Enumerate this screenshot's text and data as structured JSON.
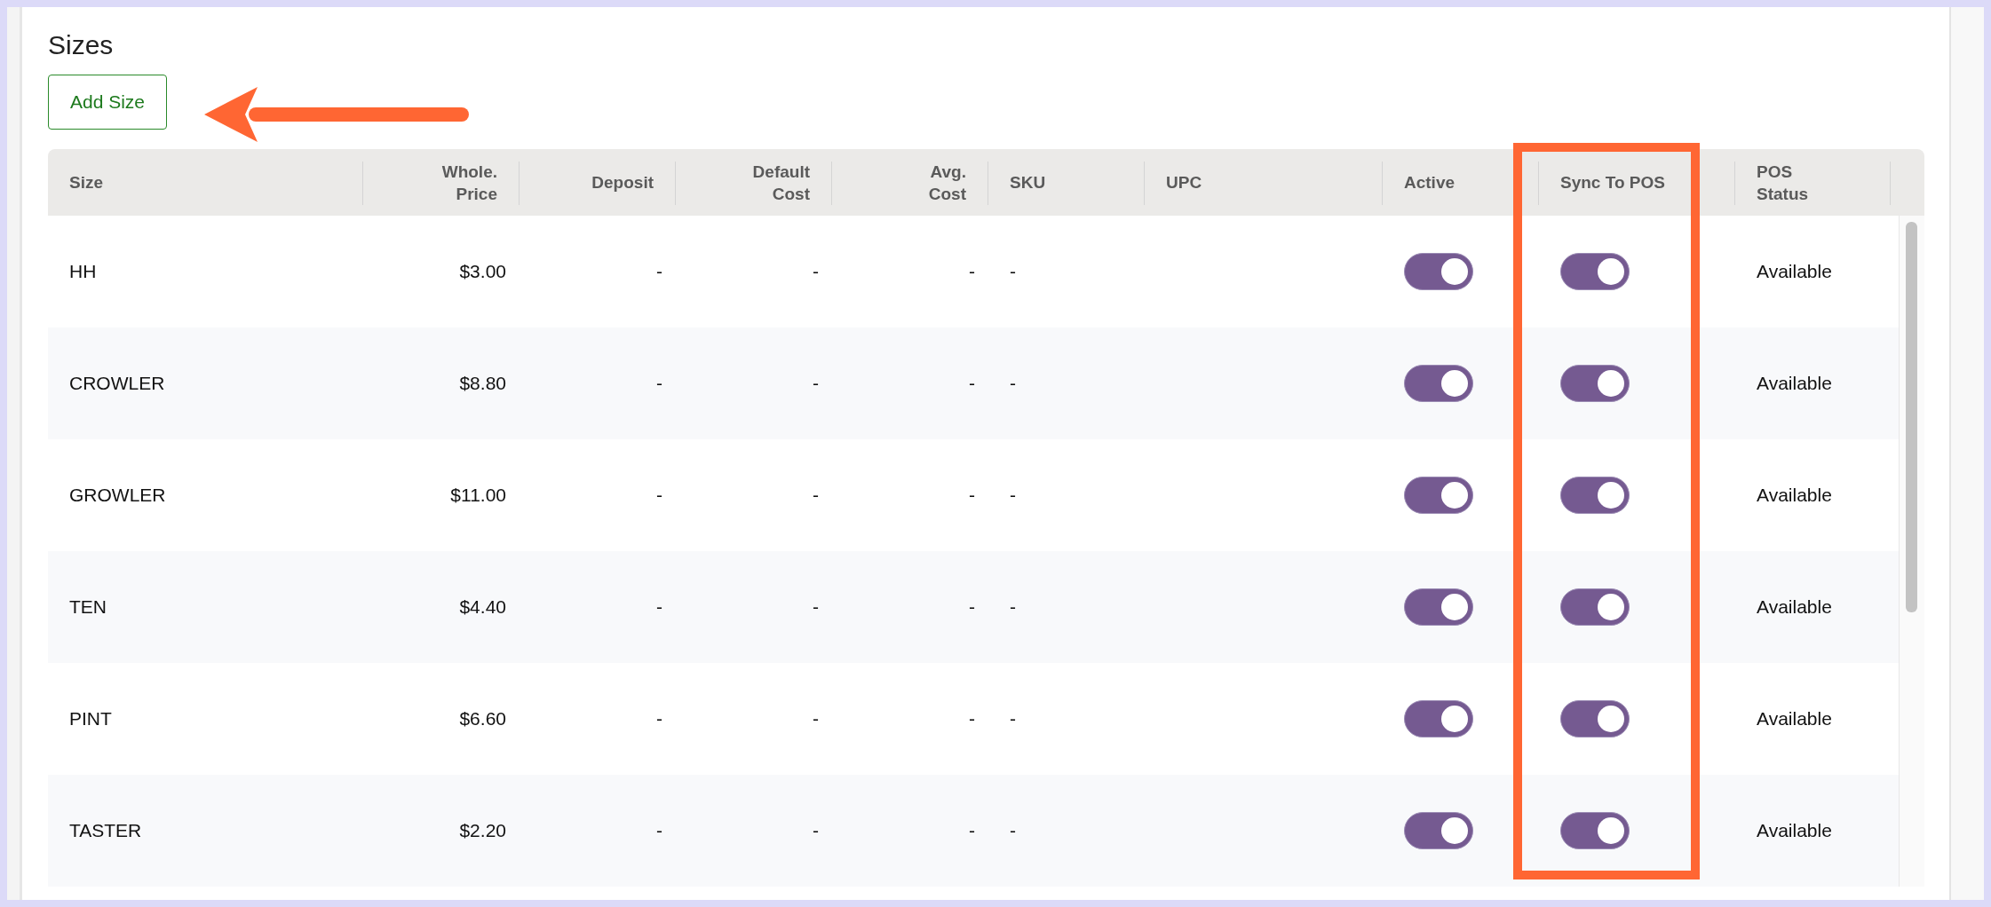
{
  "title": "Sizes",
  "add_button": {
    "label": "Add Size"
  },
  "table": {
    "columns": [
      {
        "lines": [
          "Size"
        ],
        "kind": "text"
      },
      {
        "lines": [
          "Whole.",
          "Price"
        ],
        "kind": "number"
      },
      {
        "lines": [
          "Deposit"
        ],
        "kind": "number"
      },
      {
        "lines": [
          "Default",
          "Cost"
        ],
        "kind": "number"
      },
      {
        "lines": [
          "Avg.",
          "Cost"
        ],
        "kind": "number"
      },
      {
        "lines": [
          "SKU"
        ],
        "kind": "text"
      },
      {
        "lines": [
          "UPC"
        ],
        "kind": "text"
      },
      {
        "lines": [
          "Active"
        ],
        "kind": "toggle"
      },
      {
        "lines": [
          "Sync To POS"
        ],
        "kind": "toggle"
      },
      {
        "lines": [
          "POS",
          "Status"
        ],
        "kind": "text"
      }
    ],
    "rows": [
      {
        "cells": [
          "HH",
          "$3.00",
          "-",
          "-",
          "-",
          "-",
          "",
          {
            "on": true
          },
          {
            "on": true
          },
          "Available"
        ]
      },
      {
        "cells": [
          "CROWLER",
          "$8.80",
          "-",
          "-",
          "-",
          "-",
          "",
          {
            "on": true
          },
          {
            "on": true
          },
          "Available"
        ]
      },
      {
        "cells": [
          "GROWLER",
          "$11.00",
          "-",
          "-",
          "-",
          "-",
          "",
          {
            "on": true
          },
          {
            "on": true
          },
          "Available"
        ]
      },
      {
        "cells": [
          "TEN",
          "$4.40",
          "-",
          "-",
          "-",
          "-",
          "",
          {
            "on": true
          },
          {
            "on": true
          },
          "Available"
        ]
      },
      {
        "cells": [
          "PINT",
          "$6.60",
          "-",
          "-",
          "-",
          "-",
          "",
          {
            "on": true
          },
          {
            "on": true
          },
          "Available"
        ]
      },
      {
        "cells": [
          "TASTER",
          "$2.20",
          "-",
          "-",
          "-",
          "-",
          "",
          {
            "on": true
          },
          {
            "on": true
          },
          "Available"
        ]
      }
    ]
  }
}
